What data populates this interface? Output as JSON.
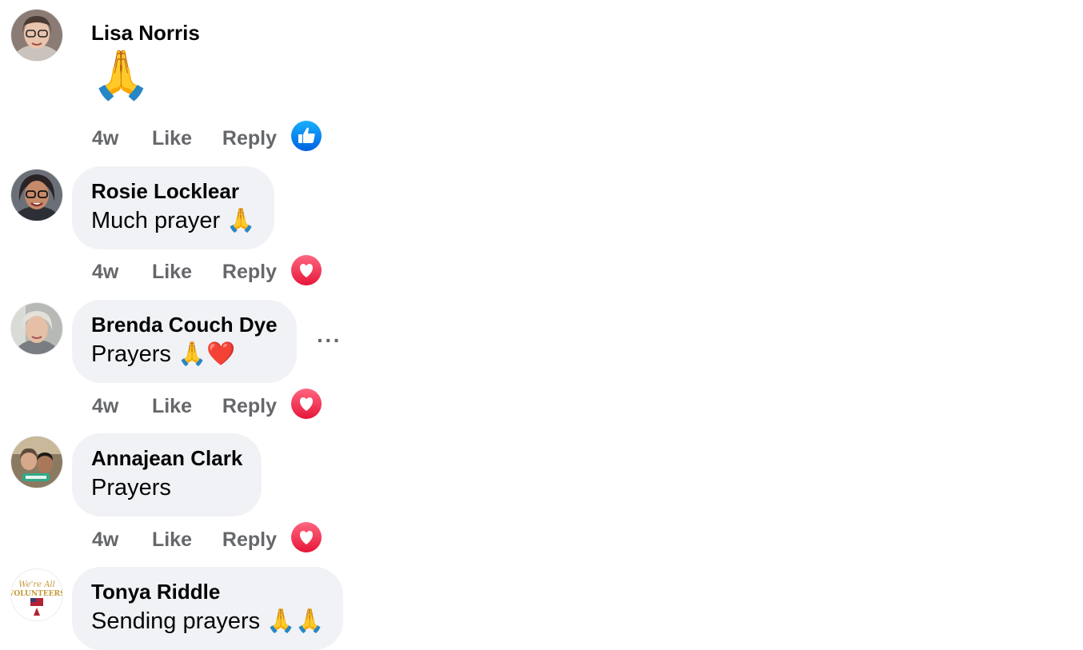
{
  "comments": [
    {
      "author": "Lisa Norris",
      "text": "🙏",
      "time": "4w",
      "like_label": "Like",
      "reply_label": "Reply",
      "reaction": "like-reaction-icon"
    },
    {
      "author": "Rosie Locklear",
      "text": "Much prayer 🙏",
      "time": "4w",
      "like_label": "Like",
      "reply_label": "Reply",
      "reaction": "love-reaction-icon"
    },
    {
      "author": "Brenda Couch Dye",
      "text": "Prayers 🙏❤️",
      "time": "4w",
      "like_label": "Like",
      "reply_label": "Reply",
      "reaction": "love-reaction-icon",
      "more_label": "···"
    },
    {
      "author": "Annajean Clark",
      "text": "Prayers",
      "time": "4w",
      "like_label": "Like",
      "reply_label": "Reply",
      "reaction": "love-reaction-icon"
    },
    {
      "author": "Tonya Riddle",
      "text": "Sending prayers 🙏🙏"
    }
  ],
  "colors": {
    "bubble": "#f0f2f5",
    "meta_text": "#65676b",
    "like_blue": "#1877f2",
    "love_red": "#f33e58"
  }
}
